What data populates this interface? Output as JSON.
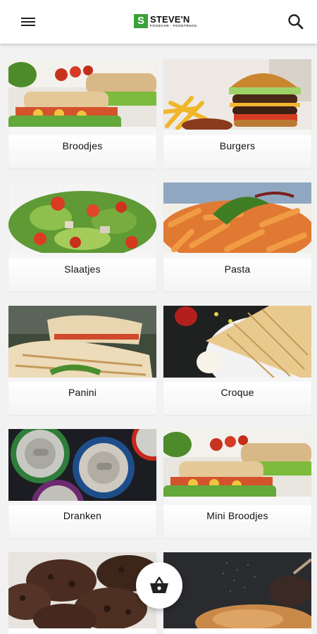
{
  "header": {
    "brand_mark": "S",
    "brand_name": "STEVE'N",
    "brand_tagline": "FOODCAR · FOODTRUCK"
  },
  "categories": [
    {
      "label": "Broodjes"
    },
    {
      "label": "Burgers"
    },
    {
      "label": "Slaatjes"
    },
    {
      "label": "Pasta"
    },
    {
      "label": "Panini"
    },
    {
      "label": "Croque"
    },
    {
      "label": "Dranken"
    },
    {
      "label": "Mini Broodjes"
    },
    {
      "label": ""
    },
    {
      "label": ""
    }
  ],
  "icons": {
    "menu": "menu-icon",
    "search": "search-icon",
    "cart": "basket-icon"
  },
  "colors": {
    "brand_green": "#3aa13a",
    "header_bg": "#ffffff",
    "page_bg": "#f2f2f2"
  }
}
